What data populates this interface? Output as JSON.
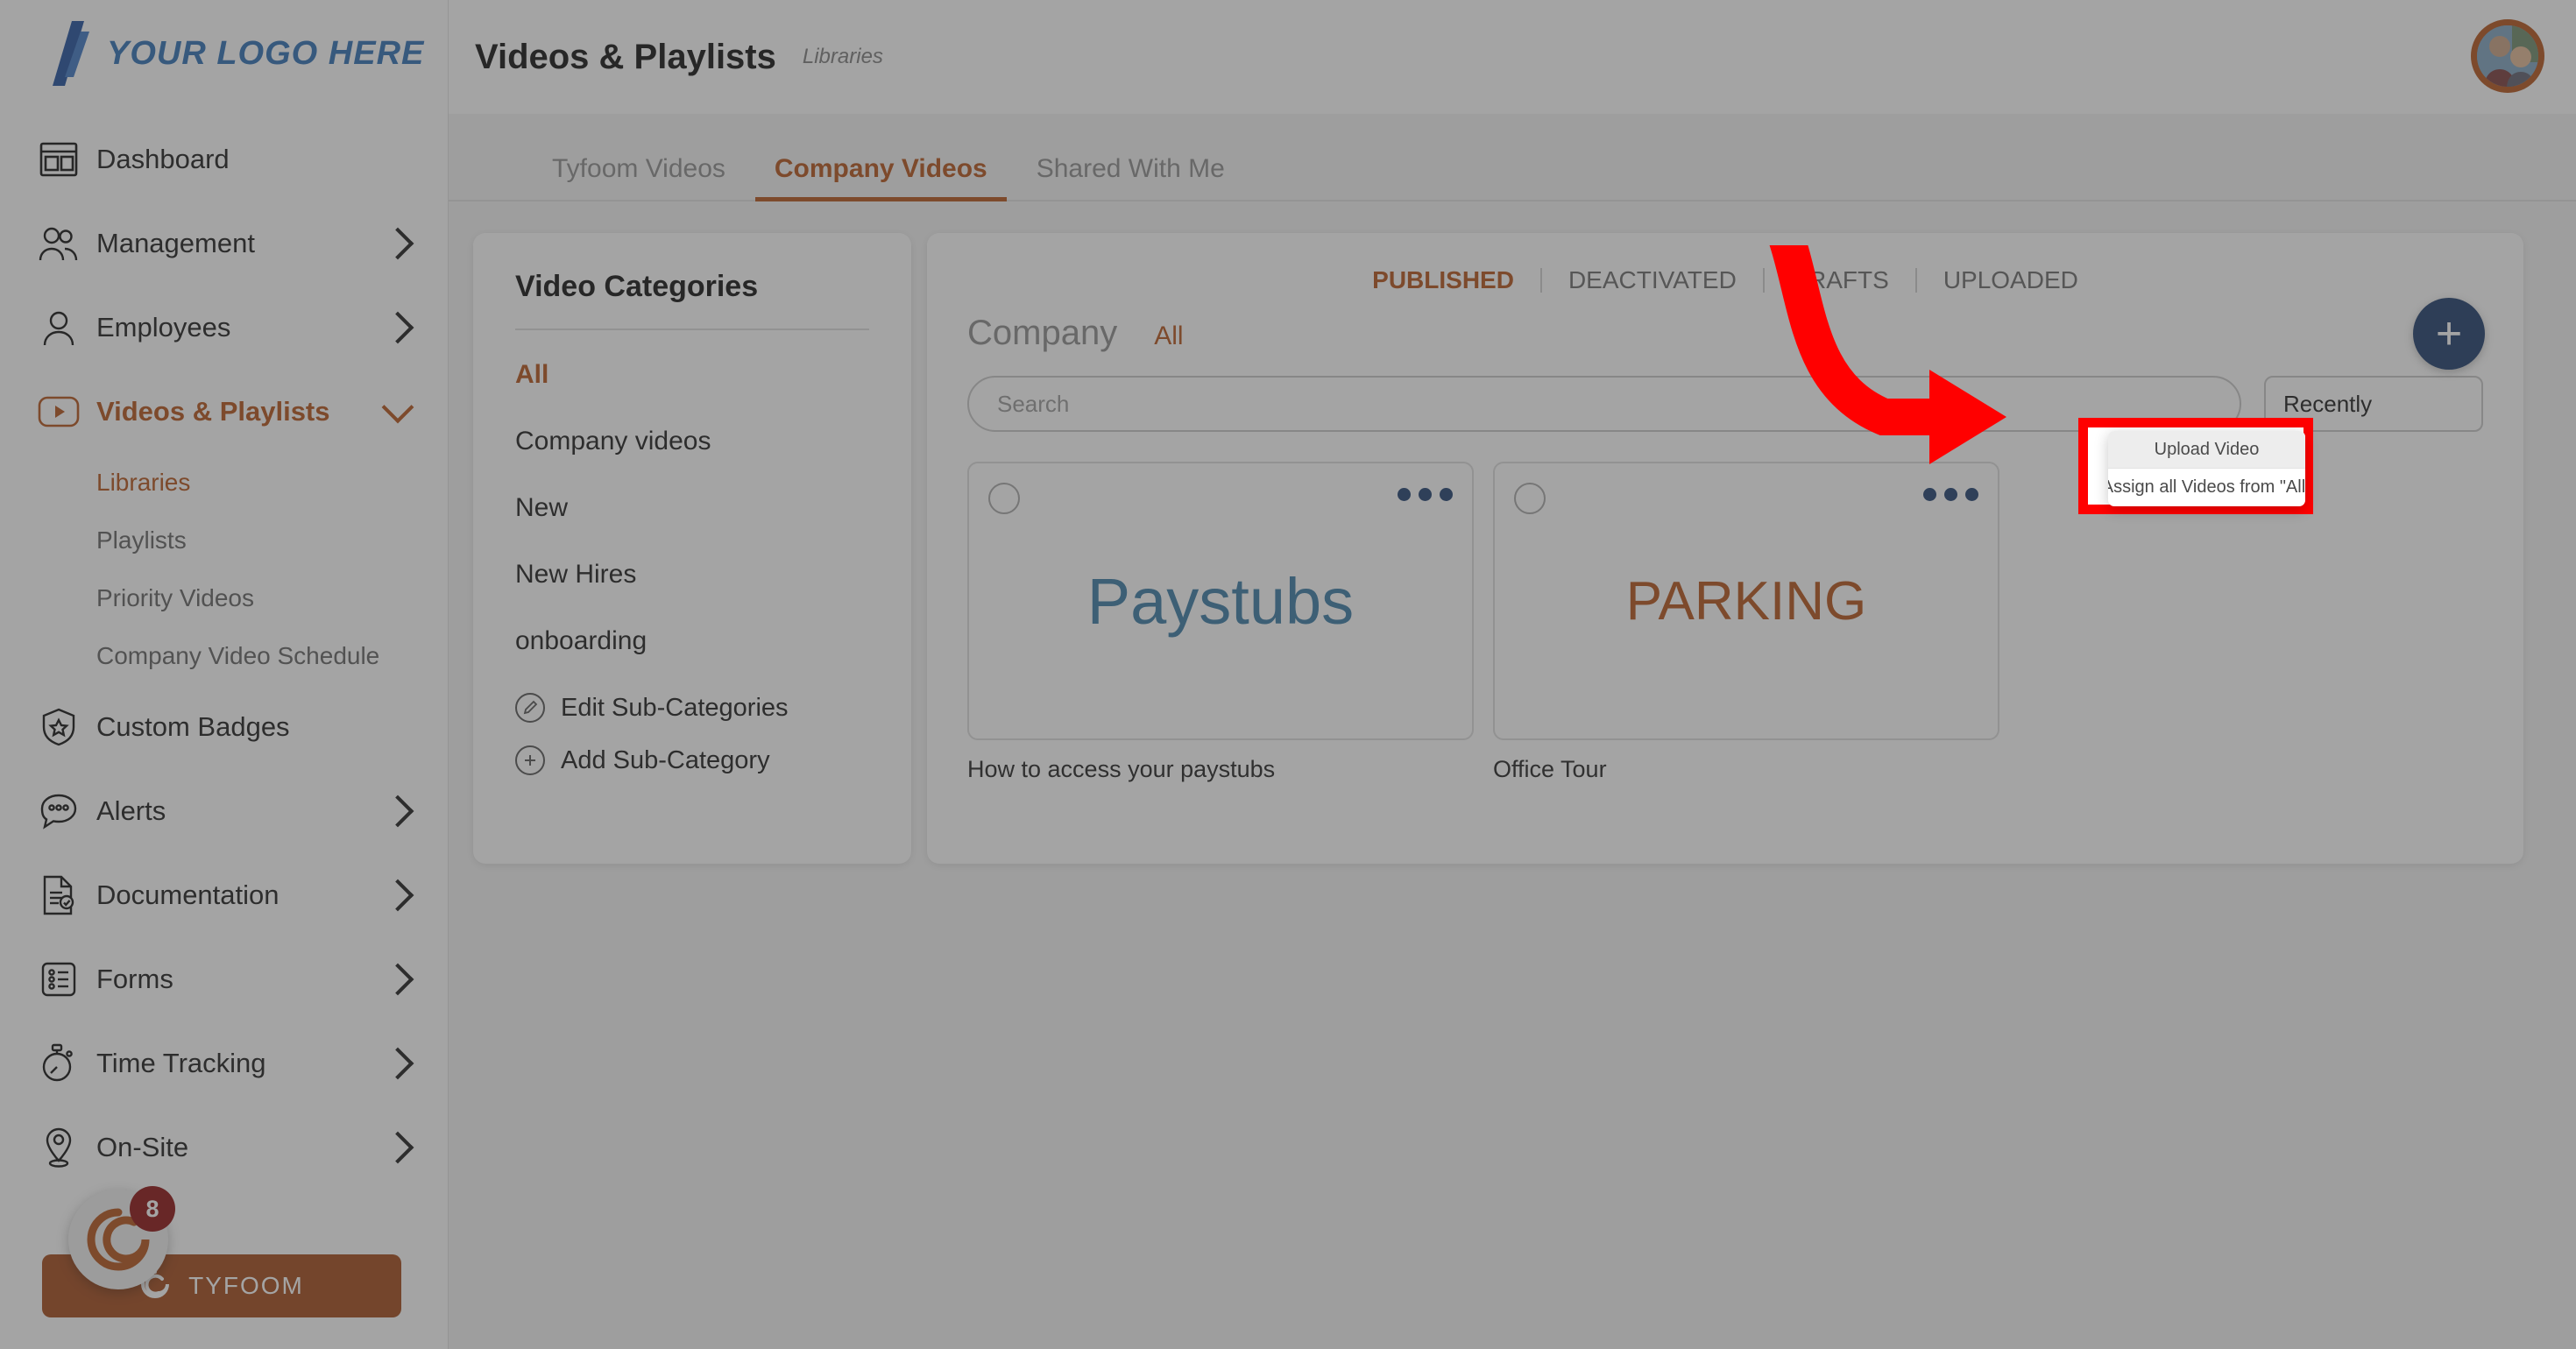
{
  "brand": {
    "logo_text": "YOUR LOGO HERE",
    "logo_color": "#2f6fb5",
    "accent_color": "#b4531a",
    "primary_blue": "#1e3d6b",
    "highlight_color": "#ff0000"
  },
  "sidebar": {
    "items": [
      {
        "label": "Dashboard",
        "icon": "dashboard-icon",
        "has_chevron": false,
        "active": false
      },
      {
        "label": "Management",
        "icon": "users-group-icon",
        "has_chevron": true,
        "active": false
      },
      {
        "label": "Employees",
        "icon": "user-icon",
        "has_chevron": true,
        "active": false
      },
      {
        "label": "Videos & Playlists",
        "icon": "video-play-icon",
        "has_chevron": true,
        "active": true
      },
      {
        "label": "Custom Badges",
        "icon": "shield-star-icon",
        "has_chevron": false,
        "active": false
      },
      {
        "label": "Alerts",
        "icon": "chat-bubble-icon",
        "has_chevron": true,
        "active": false
      },
      {
        "label": "Documentation",
        "icon": "document-check-icon",
        "has_chevron": true,
        "active": false
      },
      {
        "label": "Forms",
        "icon": "form-list-icon",
        "has_chevron": true,
        "active": false
      },
      {
        "label": "Time Tracking",
        "icon": "stopwatch-icon",
        "has_chevron": true,
        "active": false
      },
      {
        "label": "On-Site",
        "icon": "map-pin-icon",
        "has_chevron": true,
        "active": false
      }
    ],
    "subitems": [
      {
        "label": "Libraries",
        "active": true
      },
      {
        "label": "Playlists",
        "active": false
      },
      {
        "label": "Priority Videos",
        "active": false
      },
      {
        "label": "Company Video Schedule",
        "active": false
      }
    ],
    "tyfoom": {
      "button_label": "TYFOOM",
      "badge_count": "8"
    }
  },
  "header": {
    "title": "Videos & Playlists",
    "subtitle": "Libraries"
  },
  "tabs": [
    {
      "label": "Tyfoom Videos",
      "active": false
    },
    {
      "label": "Company Videos",
      "active": true
    },
    {
      "label": "Shared With Me",
      "active": false
    }
  ],
  "categories": {
    "title": "Video Categories",
    "items": [
      {
        "label": "All",
        "active": true
      },
      {
        "label": "Company videos",
        "active": false
      },
      {
        "label": "New",
        "active": false
      },
      {
        "label": "New Hires",
        "active": false
      },
      {
        "label": "onboarding",
        "active": false
      }
    ],
    "actions": [
      {
        "label": "Edit Sub-Categories",
        "icon": "pencil-icon"
      },
      {
        "label": "Add Sub-Category",
        "icon": "plus-circle-icon"
      }
    ]
  },
  "videos_panel": {
    "status_tabs": [
      {
        "label": "PUBLISHED",
        "active": true
      },
      {
        "label": "DEACTIVATED",
        "active": false
      },
      {
        "label": "DRAFTS",
        "active": false
      },
      {
        "label": "UPLOADED",
        "active": false
      }
    ],
    "company_label": "Company",
    "company_filter": "All",
    "search_placeholder": "Search",
    "sort_value": "Recently",
    "add_button_label": "+",
    "cards": [
      {
        "thumb_text": "Paystubs",
        "thumb_text_color": "#3a7ca5",
        "caption": "How to access your paystubs"
      },
      {
        "thumb_text": "PARKING",
        "thumb_text_color": "#b4531a",
        "caption": "Office Tour"
      }
    ]
  },
  "dropdown_menu": {
    "items": [
      {
        "label": "Upload Video",
        "highlighted": true
      },
      {
        "label": "Assign all Videos from \"All\"",
        "highlighted": false
      }
    ]
  }
}
